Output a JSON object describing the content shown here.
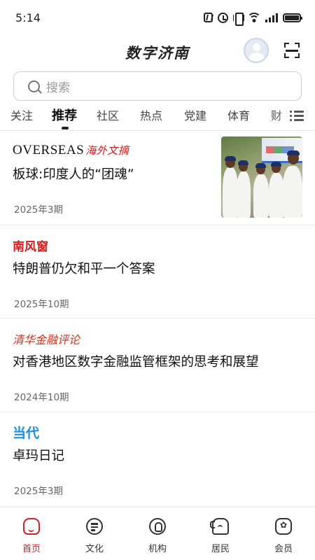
{
  "status_bar": {
    "time": "5:14"
  },
  "header": {
    "title": "数字济南",
    "search_placeholder": "搜索"
  },
  "tabs": [
    {
      "label": "关注"
    },
    {
      "label": "推荐",
      "active": true
    },
    {
      "label": "社区"
    },
    {
      "label": "热点"
    },
    {
      "label": "党建"
    },
    {
      "label": "体育"
    },
    {
      "label": "财"
    }
  ],
  "articles": [
    {
      "source": "OVERSEAS",
      "source_extra": "海外文摘",
      "title": "板球:印度人的“团魂”",
      "date": "2025年3期",
      "has_thumbnail": true
    },
    {
      "source": "南风窗",
      "title": "特朗普仍欠和平一个答案",
      "date": "2025年10期"
    },
    {
      "source": "清华金融评论",
      "title": "对香港地区数字金融监管框架的思考和展望",
      "date": "2024年10期"
    },
    {
      "source": "当代",
      "title": "卓玛日记",
      "date": "2025年3期"
    }
  ],
  "bottom_nav": [
    {
      "label": "首页",
      "icon": "home-icon",
      "active": true
    },
    {
      "label": "文化",
      "icon": "culture-icon"
    },
    {
      "label": "机构",
      "icon": "organization-icon"
    },
    {
      "label": "居民",
      "icon": "resident-icon"
    },
    {
      "label": "会员",
      "icon": "member-icon"
    }
  ],
  "colors": {
    "accent": "#c9262b",
    "tsinghua": "#c7321d",
    "dangdai": "#1f8ed8",
    "nanfengchuang": "#d21c1c"
  }
}
